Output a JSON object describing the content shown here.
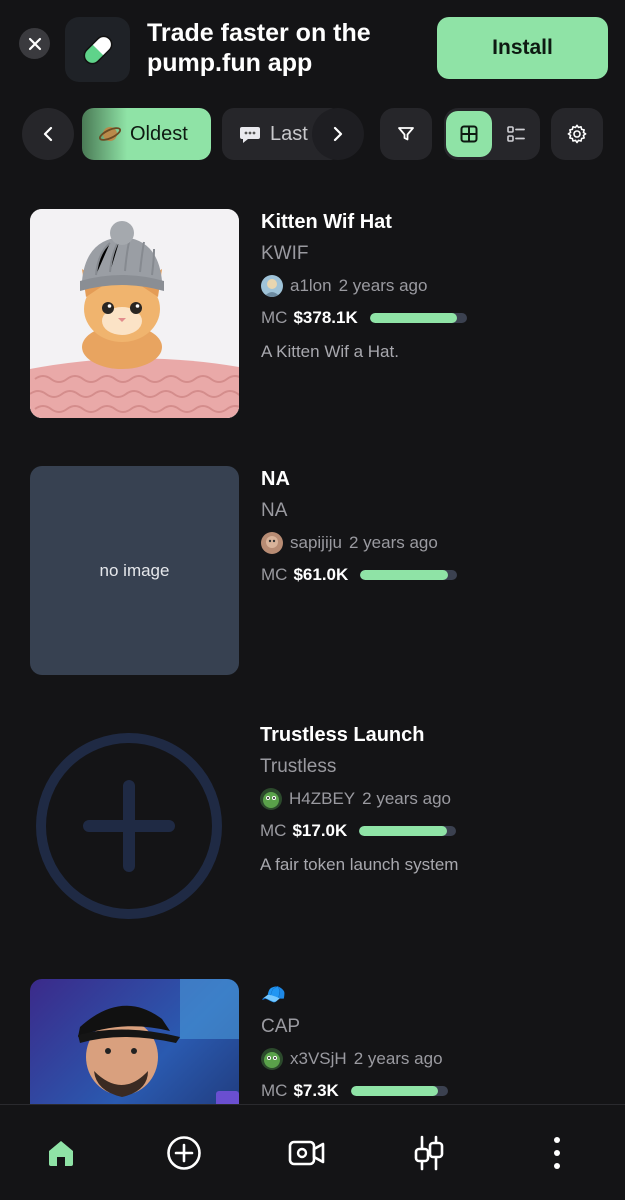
{
  "banner": {
    "title": "Trade faster on the pump.fun app",
    "install_label": "Install"
  },
  "toolbar": {
    "sort_active_label": "Oldest",
    "sort_active_icon": "ringed-planet-icon",
    "sort_next_label": "Last",
    "sort_next_icon": "speech-bubble-icon"
  },
  "tokens": [
    {
      "name": "Kitten Wif Hat",
      "ticker": "KWIF",
      "creator": "a1lon",
      "age": "2 years ago",
      "mc_label": "MC",
      "market_cap": "$378.1K",
      "progress": 0.9,
      "description": "A Kitten Wif a Hat.",
      "image": "kitten-with-knit-hat"
    },
    {
      "name": "NA",
      "ticker": "NA",
      "creator": "sapijiju",
      "age": "2 years ago",
      "mc_label": "MC",
      "market_cap": "$61.0K",
      "progress": 0.9,
      "description": "",
      "image_placeholder": "no image"
    },
    {
      "name": "Trustless Launch",
      "ticker": "Trustless",
      "creator": "H4ZBEY",
      "age": "2 years ago",
      "mc_label": "MC",
      "market_cap": "$17.0K",
      "progress": 0.9,
      "description": "A fair token launch system",
      "image": "plus-in-circle"
    },
    {
      "name": "🧢",
      "ticker": "CAP",
      "creator": "x3VSjH",
      "age": "2 years ago",
      "mc_label": "MC",
      "market_cap": "$7.3K",
      "progress": 0.9,
      "description": "",
      "image": "man-in-cap-photo"
    }
  ],
  "bottom_nav": [
    "home-icon",
    "create-icon",
    "live-video-icon",
    "chart-icon",
    "more-icon"
  ],
  "colors": {
    "accent": "#8fe3a6",
    "background": "#141416",
    "surface": "#26262a",
    "muted_text": "#9a9aa0"
  }
}
